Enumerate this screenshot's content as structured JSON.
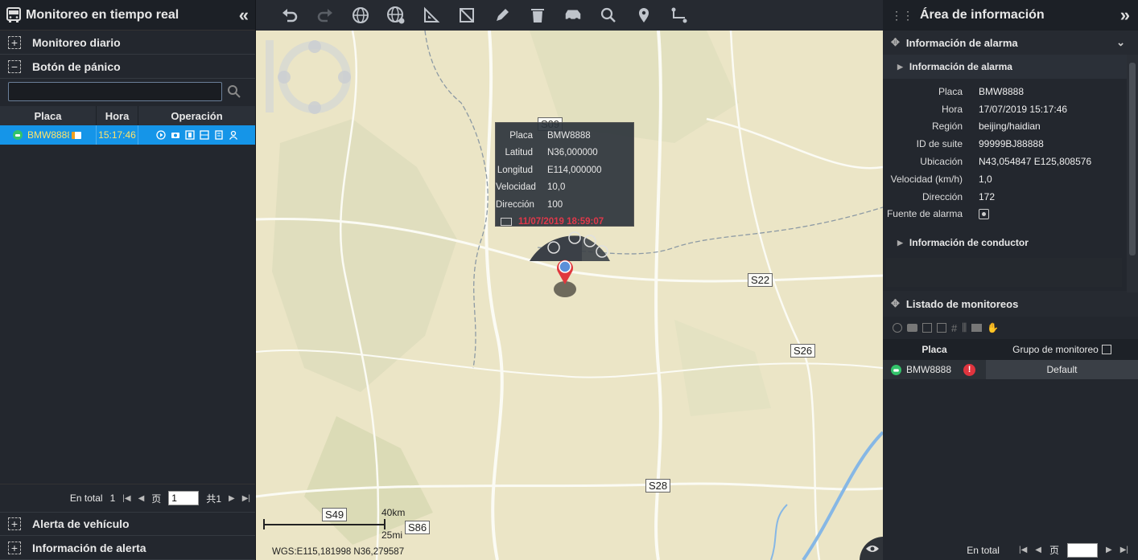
{
  "left_panel": {
    "title": "Monitoreo en tiempo real",
    "sections": {
      "daily": "Monitoreo diario",
      "panic": "Botón de pánico",
      "vehicle_alert": "Alerta de vehículo",
      "alert_info": "Información de alerta"
    },
    "table": {
      "headers": [
        "Placa",
        "Hora",
        "Operación"
      ],
      "row": {
        "plate": "BMW8888",
        "time": "15:17:46"
      }
    },
    "footer": {
      "total_label": "En total",
      "total": "1",
      "page_label": "页",
      "page": "1",
      "of_label": "共",
      "of": "1"
    }
  },
  "toolbar": {
    "icons": [
      "undo-icon",
      "redo-icon",
      "globe-icon",
      "globe-settings-icon",
      "ruler-triangle-icon",
      "area-icon",
      "pencil-icon",
      "trash-icon",
      "vehicle-icon",
      "search-icon",
      "location-pin-icon",
      "route-icon"
    ]
  },
  "map": {
    "popup": {
      "rows": [
        {
          "k": "Placa",
          "v": "BMW8888"
        },
        {
          "k": "Latitud",
          "v": "N36,000000"
        },
        {
          "k": "Longitud",
          "v": "E114,000000"
        },
        {
          "k": "Velocidad",
          "v": "10,0"
        },
        {
          "k": "Dirección",
          "v": "100"
        }
      ],
      "timestamp": "11/07/2019 18:59:07"
    },
    "roads": [
      "S22",
      "S26",
      "S28",
      "S49",
      "S86",
      "S09"
    ],
    "scale": {
      "km": "40km",
      "mi": "25mi"
    },
    "coords": "WGS:E115,181998 N36,279587"
  },
  "right_panel": {
    "title": "Área de información",
    "alarm_section": "Información de alarma",
    "alarm_sub": "Información de alarma",
    "fields": [
      {
        "k": "Placa",
        "v": "BMW8888"
      },
      {
        "k": "Hora",
        "v": "17/07/2019 15:17:46"
      },
      {
        "k": "Región",
        "v": "beijing/haidian"
      },
      {
        "k": "ID de suite",
        "v": "99999BJ88888"
      },
      {
        "k": "Ubicación",
        "v": "N43,054847 E125,808576"
      },
      {
        "k": "Velocidad (km/h)",
        "v": "1,0"
      },
      {
        "k": "Dirección",
        "v": "172"
      },
      {
        "k": "Fuente de alarma",
        "v": ""
      }
    ],
    "driver_sub": "Información de conductor",
    "monitor_section": "Listado de monitoreos",
    "monitor_table": {
      "headers": [
        "Placa",
        "Grupo de monitoreo"
      ],
      "row": {
        "plate": "BMW8888",
        "group": "Default"
      }
    },
    "footer": {
      "total_label": "En total",
      "page_label": "页"
    }
  }
}
